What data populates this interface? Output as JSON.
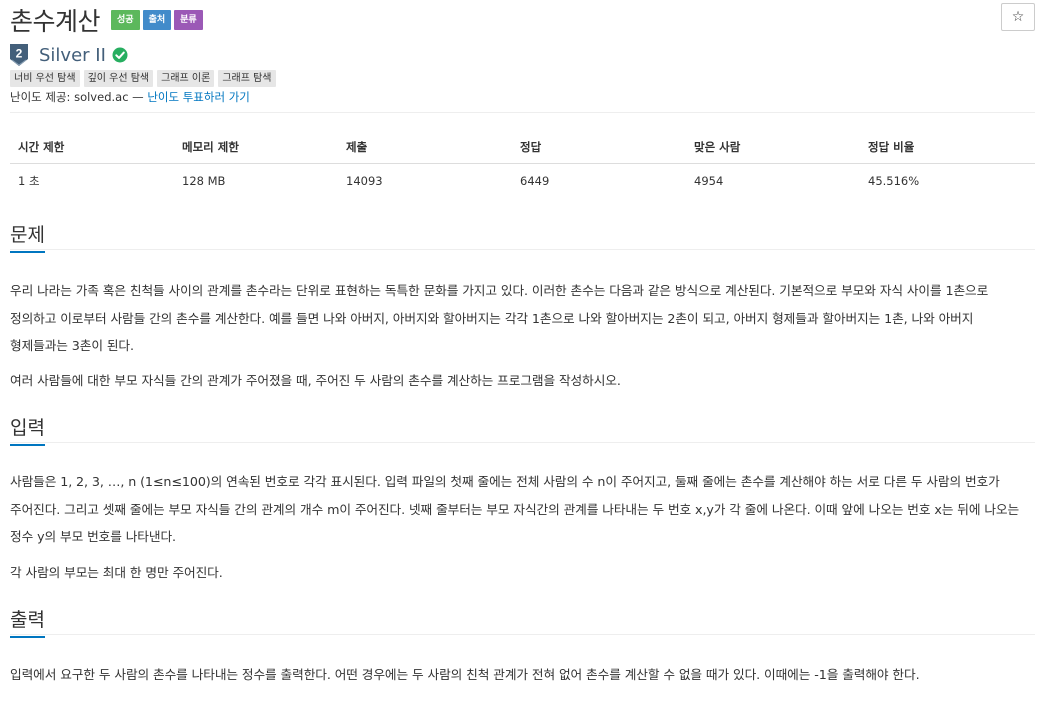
{
  "header": {
    "title": "촌수계산",
    "labels": [
      {
        "text": "성공",
        "color": "#5cb85c"
      },
      {
        "text": "출처",
        "color": "#428bca"
      },
      {
        "text": "분류",
        "color": "#9b59b6"
      }
    ],
    "star": "☆"
  },
  "tier": {
    "badge_number": "2",
    "name": "Silver II",
    "solved": true,
    "color": "#435f7a"
  },
  "tags": [
    "너비 우선 탐색",
    "깊이 우선 탐색",
    "그래프 이론",
    "그래프 탐색"
  ],
  "provider": {
    "prefix": "난이도 제공: solved.ac — ",
    "link": "난이도 투표하러 가기"
  },
  "stats": {
    "headers": [
      "시간 제한",
      "메모리 제한",
      "제출",
      "정답",
      "맞은 사람",
      "정답 비율"
    ],
    "values": [
      "1 초",
      "128 MB",
      "14093",
      "6449",
      "4954",
      "45.516%"
    ]
  },
  "problem": {
    "heading": "문제",
    "paragraphs": [
      "우리 나라는 가족 혹은 친척들 사이의 관계를 촌수라는 단위로 표현하는 독특한 문화를 가지고 있다. 이러한 촌수는 다음과 같은 방식으로 계산된다. 기본적으로 부모와 자식 사이를 1촌으로 정의하고 이로부터 사람들 간의 촌수를 계산한다. 예를 들면 나와 아버지, 아버지와 할아버지는 각각 1촌으로 나와 할아버지는 2촌이 되고, 아버지 형제들과 할아버지는 1촌, 나와 아버지 형제들과는 3촌이 된다.",
      "여러 사람들에 대한 부모 자식들 간의 관계가 주어졌을 때, 주어진 두 사람의 촌수를 계산하는 프로그램을 작성하시오."
    ]
  },
  "input": {
    "heading": "입력",
    "paragraphs": [
      "사람들은 1, 2, 3, …, n (1≤n≤100)의 연속된 번호로 각각 표시된다. 입력 파일의 첫째 줄에는 전체 사람의 수 n이 주어지고, 둘째 줄에는 촌수를 계산해야 하는 서로 다른 두 사람의 번호가 주어진다. 그리고 셋째 줄에는 부모 자식들 간의 관계의 개수 m이 주어진다. 넷째 줄부터는 부모 자식간의 관계를 나타내는 두 번호 x,y가 각 줄에 나온다. 이때 앞에 나오는 번호 x는 뒤에 나오는 정수 y의 부모 번호를 나타낸다.",
      "각 사람의 부모는 최대 한 명만 주어진다."
    ]
  },
  "output": {
    "heading": "출력",
    "paragraphs": [
      "입력에서 요구한 두 사람의 촌수를 나타내는 정수를 출력한다. 어떤 경우에는 두 사람의 친척 관계가 전혀 없어 촌수를 계산할 수 없을 때가 있다. 이때에는 -1을 출력해야 한다."
    ]
  }
}
